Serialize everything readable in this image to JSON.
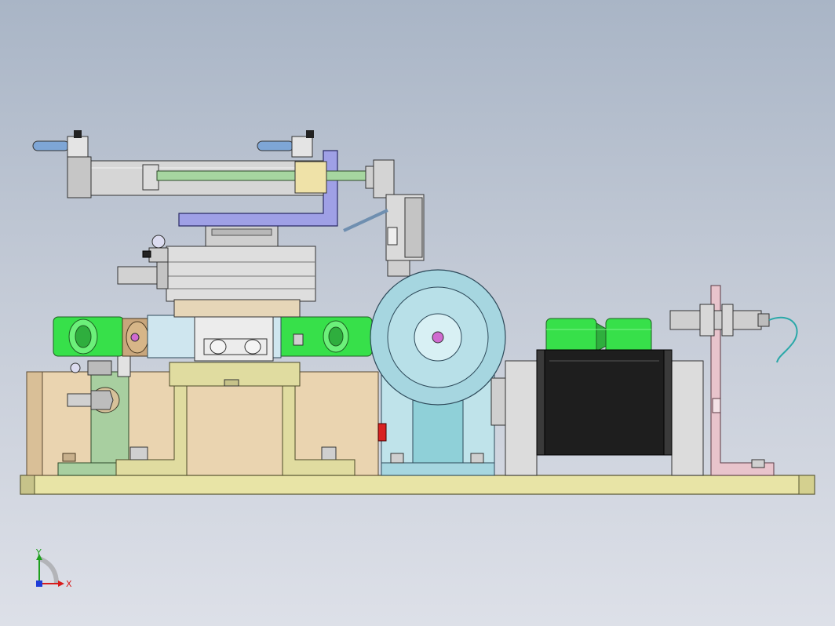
{
  "viewport": {
    "background_top": "#a9b5c6",
    "background_bottom": "#dde0e8"
  },
  "triad": {
    "x_label": "X",
    "y_label": "Y",
    "x_color": "#d81b1b",
    "y_color": "#1ea01e",
    "z_color": "#1e3cd8"
  },
  "colors": {
    "base_plate": "#e8e4a6",
    "tan_block": "#ead4b0",
    "bracket": "#e0dca0",
    "cylinder": "#d6d6d6",
    "purple_arm": "#9fa0e6",
    "green_roller": "#37e04a",
    "teal_disk": "#a6d6e0",
    "black_drum": "#1e1e1e",
    "pink_bracket": "#e8c4cc",
    "cable": "#2aa8a8"
  }
}
